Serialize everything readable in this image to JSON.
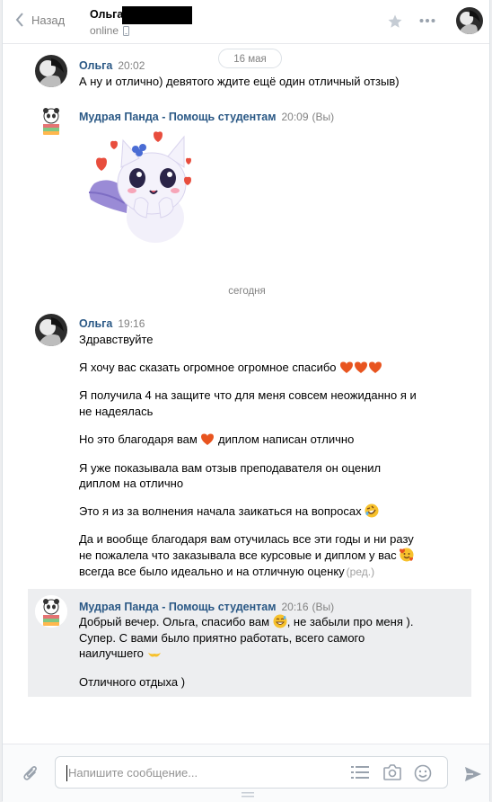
{
  "header": {
    "back_label": "Назад",
    "peer_name": "Ольга",
    "peer_status": "online"
  },
  "dates": {
    "first": "16 мая",
    "today": "сегодня"
  },
  "messages": [
    {
      "author": "Ольга",
      "time": "20:02",
      "lines": [
        "А ну и отлично) девятого ждите ещё один отличный отзыв)"
      ]
    },
    {
      "author": "Мудрая Панда - Помощь студентам",
      "time": "20:09",
      "tag": "(Вы)",
      "sticker": "cat-sticker"
    },
    {
      "author": "Ольга",
      "time": "19:16",
      "lines": [
        "Здравствуйте",
        "Я хочу вас сказать огромное огромное спасибо",
        "Я получила 4 на защите что для меня совсем неожиданно я и",
        "не надеялась",
        "Но это благодаря вам",
        "диплом написан отлично",
        "Я уже показывала вам отзыв преподавателя он оценил",
        "диплом на отлично",
        "Это я из за волнения начала заикаться на вопросах",
        "Да и вообще благодаря вам отучилась все эти годы и ни разу",
        "не пожалела что заказывала все курсовые и диплом у вас",
        "всегда все было идеально и на отличную оценку"
      ],
      "edited": "(ред.)"
    },
    {
      "author": "Мудрая Панда - Помощь студентам",
      "time": "20:16",
      "tag": "(Вы)",
      "lines": [
        "Добрый вечер. Ольга, спасибо вам",
        ", не забыли про меня ).",
        "Супер. С вами было приятно работать, всего самого",
        "наилучшего",
        "Отличного отдыха )"
      ]
    }
  ],
  "composer": {
    "placeholder": "Напишите сообщение..."
  },
  "icons": [
    "back-chevron-icon",
    "star-icon",
    "more-icon",
    "phone-icon",
    "heart-icon",
    "rofl-emoji-icon",
    "smiling-face-hearts-icon",
    "sweat-smile-icon",
    "hands-icon",
    "paperclip-icon",
    "list-icon",
    "camera-icon",
    "smile-icon",
    "send-icon"
  ],
  "colors": {
    "link": "#2a5885",
    "muted": "#828282",
    "highlight": "#edeef0"
  }
}
